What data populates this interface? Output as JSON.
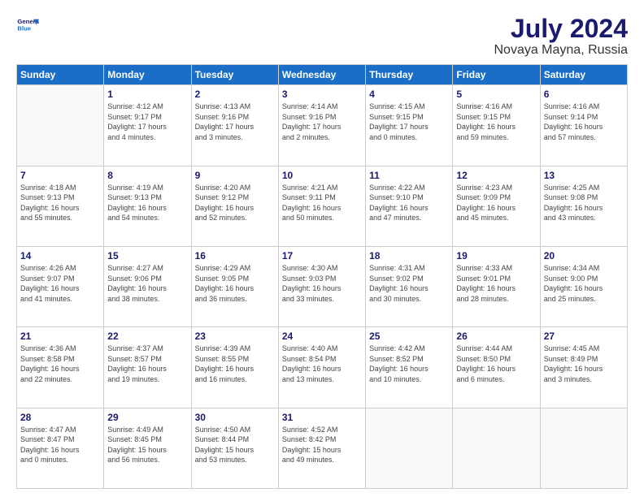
{
  "header": {
    "logo_line1": "General",
    "logo_line2": "Blue",
    "title": "July 2024",
    "subtitle": "Novaya Mayna, Russia"
  },
  "calendar": {
    "days_of_week": [
      "Sunday",
      "Monday",
      "Tuesday",
      "Wednesday",
      "Thursday",
      "Friday",
      "Saturday"
    ],
    "weeks": [
      [
        {
          "day": "",
          "info": ""
        },
        {
          "day": "1",
          "info": "Sunrise: 4:12 AM\nSunset: 9:17 PM\nDaylight: 17 hours\nand 4 minutes."
        },
        {
          "day": "2",
          "info": "Sunrise: 4:13 AM\nSunset: 9:16 PM\nDaylight: 17 hours\nand 3 minutes."
        },
        {
          "day": "3",
          "info": "Sunrise: 4:14 AM\nSunset: 9:16 PM\nDaylight: 17 hours\nand 2 minutes."
        },
        {
          "day": "4",
          "info": "Sunrise: 4:15 AM\nSunset: 9:15 PM\nDaylight: 17 hours\nand 0 minutes."
        },
        {
          "day": "5",
          "info": "Sunrise: 4:16 AM\nSunset: 9:15 PM\nDaylight: 16 hours\nand 59 minutes."
        },
        {
          "day": "6",
          "info": "Sunrise: 4:16 AM\nSunset: 9:14 PM\nDaylight: 16 hours\nand 57 minutes."
        }
      ],
      [
        {
          "day": "7",
          "info": "Sunrise: 4:18 AM\nSunset: 9:13 PM\nDaylight: 16 hours\nand 55 minutes."
        },
        {
          "day": "8",
          "info": "Sunrise: 4:19 AM\nSunset: 9:13 PM\nDaylight: 16 hours\nand 54 minutes."
        },
        {
          "day": "9",
          "info": "Sunrise: 4:20 AM\nSunset: 9:12 PM\nDaylight: 16 hours\nand 52 minutes."
        },
        {
          "day": "10",
          "info": "Sunrise: 4:21 AM\nSunset: 9:11 PM\nDaylight: 16 hours\nand 50 minutes."
        },
        {
          "day": "11",
          "info": "Sunrise: 4:22 AM\nSunset: 9:10 PM\nDaylight: 16 hours\nand 47 minutes."
        },
        {
          "day": "12",
          "info": "Sunrise: 4:23 AM\nSunset: 9:09 PM\nDaylight: 16 hours\nand 45 minutes."
        },
        {
          "day": "13",
          "info": "Sunrise: 4:25 AM\nSunset: 9:08 PM\nDaylight: 16 hours\nand 43 minutes."
        }
      ],
      [
        {
          "day": "14",
          "info": "Sunrise: 4:26 AM\nSunset: 9:07 PM\nDaylight: 16 hours\nand 41 minutes."
        },
        {
          "day": "15",
          "info": "Sunrise: 4:27 AM\nSunset: 9:06 PM\nDaylight: 16 hours\nand 38 minutes."
        },
        {
          "day": "16",
          "info": "Sunrise: 4:29 AM\nSunset: 9:05 PM\nDaylight: 16 hours\nand 36 minutes."
        },
        {
          "day": "17",
          "info": "Sunrise: 4:30 AM\nSunset: 9:03 PM\nDaylight: 16 hours\nand 33 minutes."
        },
        {
          "day": "18",
          "info": "Sunrise: 4:31 AM\nSunset: 9:02 PM\nDaylight: 16 hours\nand 30 minutes."
        },
        {
          "day": "19",
          "info": "Sunrise: 4:33 AM\nSunset: 9:01 PM\nDaylight: 16 hours\nand 28 minutes."
        },
        {
          "day": "20",
          "info": "Sunrise: 4:34 AM\nSunset: 9:00 PM\nDaylight: 16 hours\nand 25 minutes."
        }
      ],
      [
        {
          "day": "21",
          "info": "Sunrise: 4:36 AM\nSunset: 8:58 PM\nDaylight: 16 hours\nand 22 minutes."
        },
        {
          "day": "22",
          "info": "Sunrise: 4:37 AM\nSunset: 8:57 PM\nDaylight: 16 hours\nand 19 minutes."
        },
        {
          "day": "23",
          "info": "Sunrise: 4:39 AM\nSunset: 8:55 PM\nDaylight: 16 hours\nand 16 minutes."
        },
        {
          "day": "24",
          "info": "Sunrise: 4:40 AM\nSunset: 8:54 PM\nDaylight: 16 hours\nand 13 minutes."
        },
        {
          "day": "25",
          "info": "Sunrise: 4:42 AM\nSunset: 8:52 PM\nDaylight: 16 hours\nand 10 minutes."
        },
        {
          "day": "26",
          "info": "Sunrise: 4:44 AM\nSunset: 8:50 PM\nDaylight: 16 hours\nand 6 minutes."
        },
        {
          "day": "27",
          "info": "Sunrise: 4:45 AM\nSunset: 8:49 PM\nDaylight: 16 hours\nand 3 minutes."
        }
      ],
      [
        {
          "day": "28",
          "info": "Sunrise: 4:47 AM\nSunset: 8:47 PM\nDaylight: 16 hours\nand 0 minutes."
        },
        {
          "day": "29",
          "info": "Sunrise: 4:49 AM\nSunset: 8:45 PM\nDaylight: 15 hours\nand 56 minutes."
        },
        {
          "day": "30",
          "info": "Sunrise: 4:50 AM\nSunset: 8:44 PM\nDaylight: 15 hours\nand 53 minutes."
        },
        {
          "day": "31",
          "info": "Sunrise: 4:52 AM\nSunset: 8:42 PM\nDaylight: 15 hours\nand 49 minutes."
        },
        {
          "day": "",
          "info": ""
        },
        {
          "day": "",
          "info": ""
        },
        {
          "day": "",
          "info": ""
        }
      ]
    ]
  }
}
